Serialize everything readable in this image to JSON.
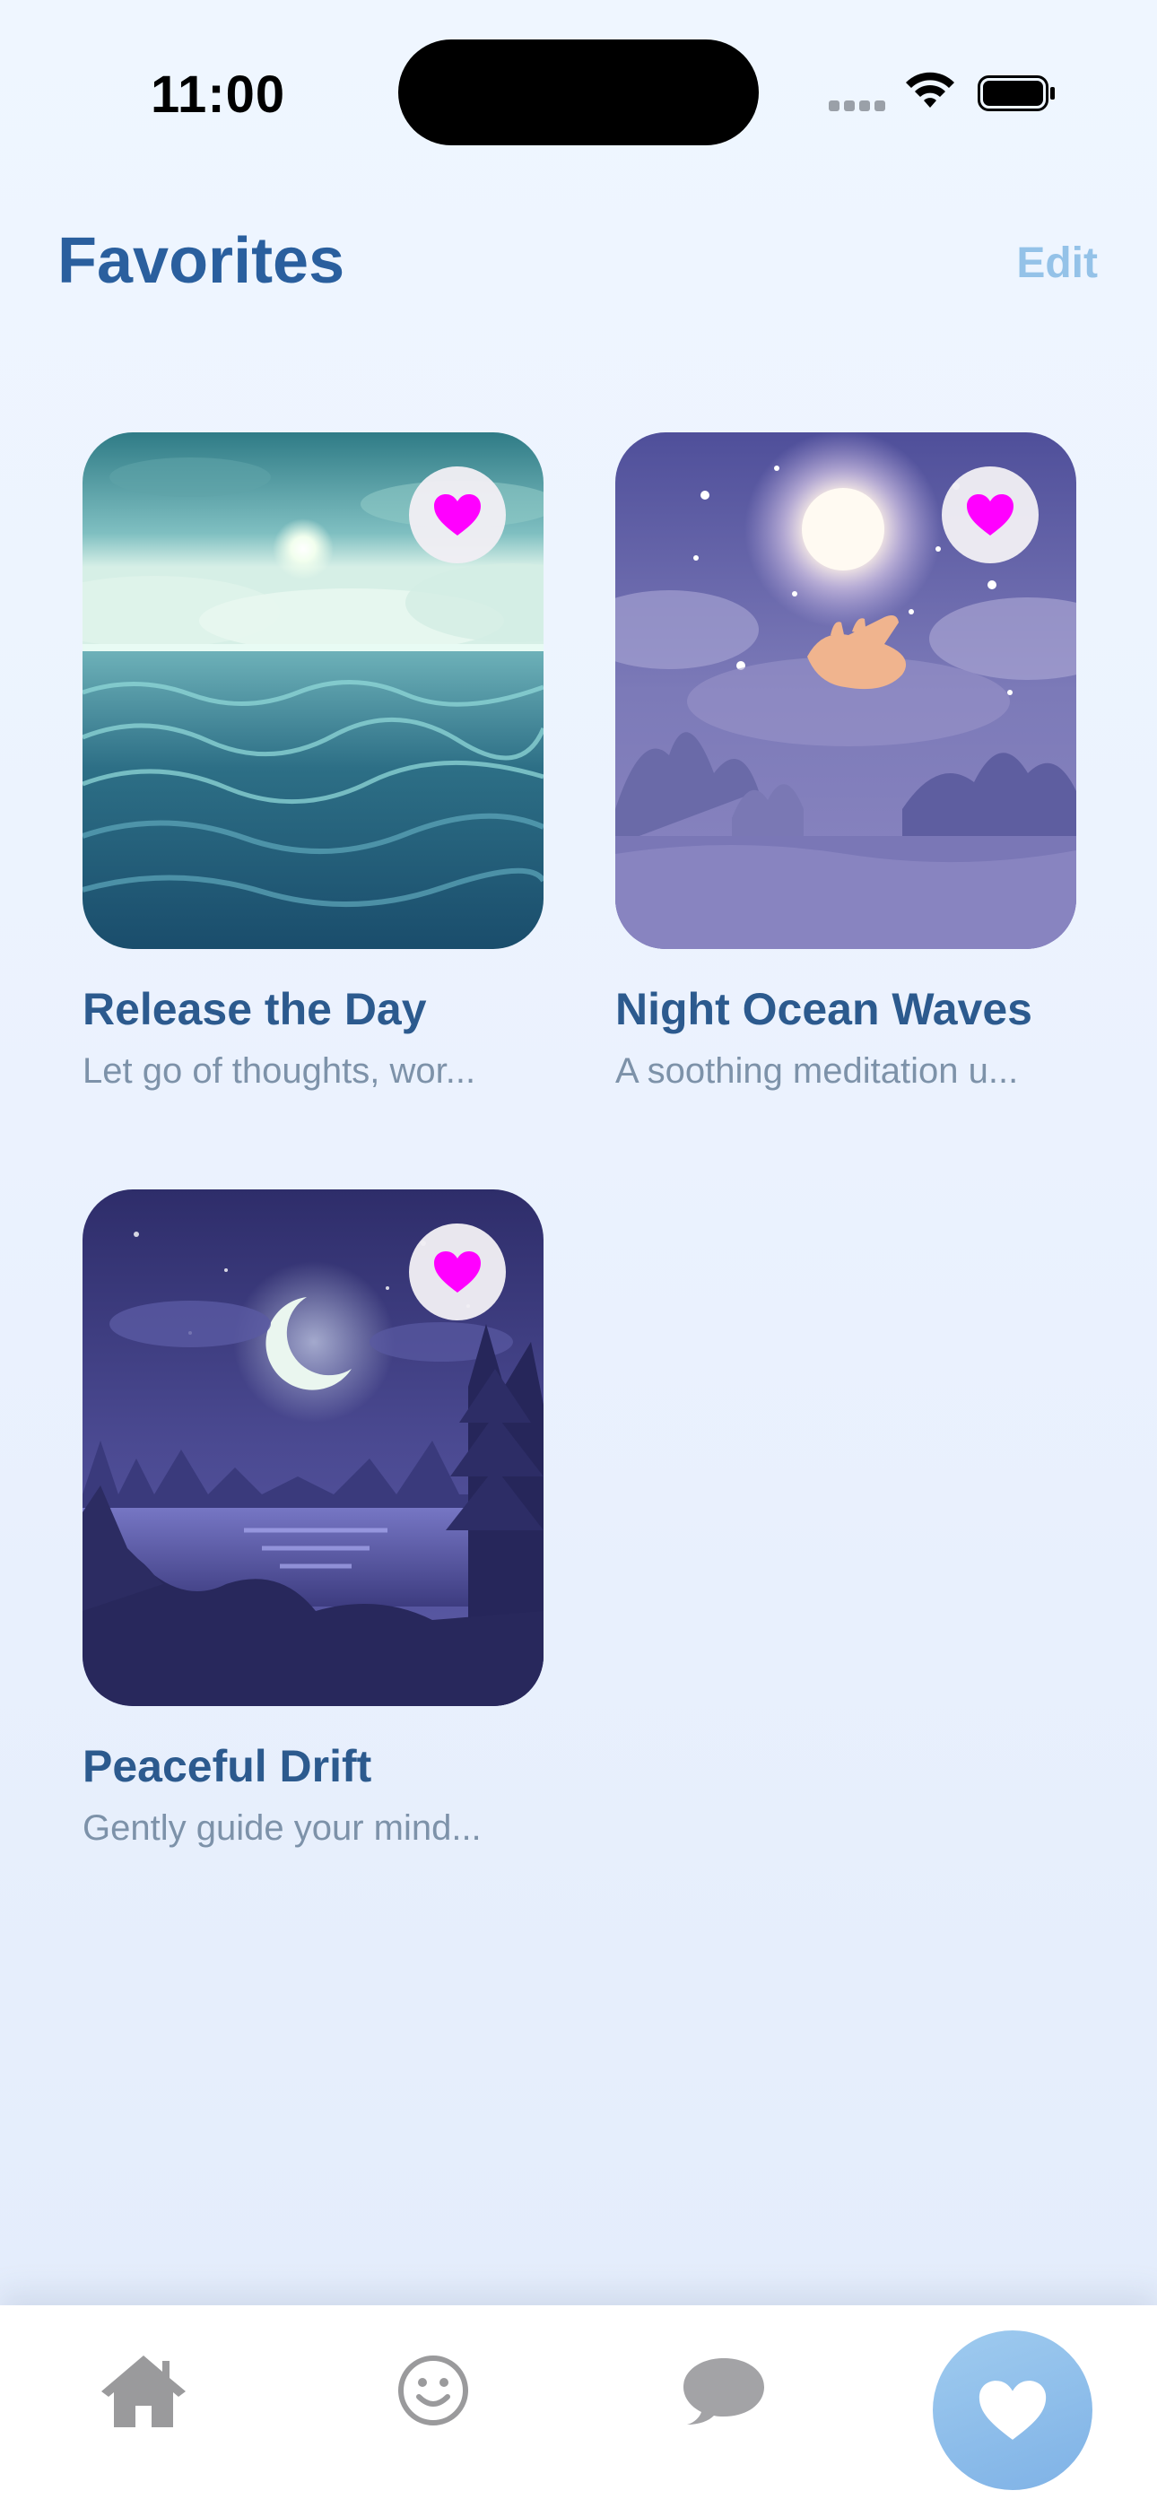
{
  "status_bar": {
    "time": "11:00"
  },
  "header": {
    "title": "Favorites",
    "edit_label": "Edit"
  },
  "favorites": [
    {
      "title": "Release the Day",
      "subtitle": "Let go of thoughts, wor...",
      "artwork": "ocean-waves-moon",
      "favorited": true
    },
    {
      "title": "Night Ocean Waves",
      "subtitle": "A soothing meditation u...",
      "artwork": "hand-reaching-glowing-orb",
      "favorited": true
    },
    {
      "title": "Peaceful Drift",
      "subtitle": "Gently guide your mind...",
      "artwork": "crescent-moon-lake-forest",
      "favorited": true
    }
  ],
  "tab_bar": {
    "tabs": [
      {
        "icon": "home-icon",
        "selected": false
      },
      {
        "icon": "smiley-icon",
        "selected": false
      },
      {
        "icon": "chat-bubble-icon",
        "selected": false
      },
      {
        "icon": "heart-icon",
        "selected": true
      }
    ]
  },
  "colors": {
    "title": "#2a5f9e",
    "edit": "#94c2e8",
    "heart": "#ff00ff",
    "tab_active_bg": "#8dbdea",
    "tab_inactive_icon": "#9a9a9c"
  }
}
